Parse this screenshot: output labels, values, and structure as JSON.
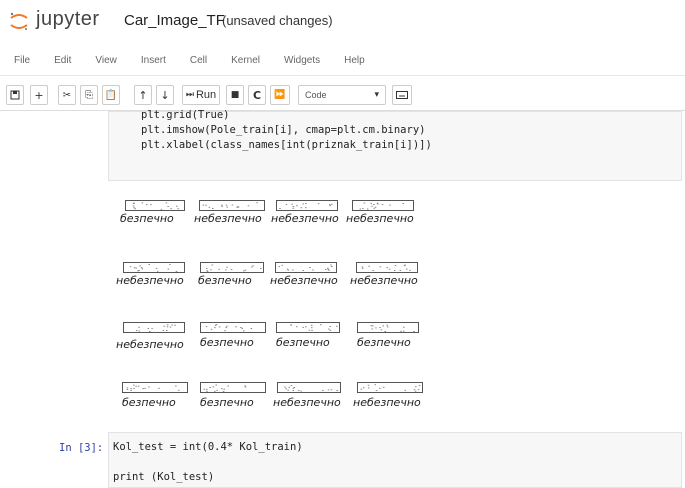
{
  "header": {
    "brand": "jupyter",
    "notebook_name": "Car_Image_TF",
    "save_state": "(unsaved changes)"
  },
  "menu": [
    "File",
    "Edit",
    "View",
    "Insert",
    "Cell",
    "Kernel",
    "Widgets",
    "Help"
  ],
  "toolbar": {
    "run_label": "Run",
    "cell_type": "Code",
    "icons": [
      "save-icon",
      "plus-icon",
      "cut-icon",
      "copy-icon",
      "paste-icon",
      "arrow-up-icon",
      "arrow-down-icon",
      "step-forward-icon",
      "stop-icon",
      "restart-icon",
      "fast-forward-icon",
      "keyboard-icon"
    ]
  },
  "code_cell": {
    "lines": [
      "plt.grid(True)",
      "plt.imshow(Pole_train[i], cmap=plt.cm.binary)",
      "plt.xlabel(class_names[int(priznak_train[i])])"
    ]
  },
  "output": {
    "rows": [
      [
        "безпечно",
        "небезпечно",
        "небезпечно",
        "небезпечно"
      ],
      [
        "небезпечно",
        "безпечно",
        "небезпечно",
        "небезпечно"
      ],
      [
        "небезпечно",
        "безпечно",
        "безпечно",
        "безпечно"
      ],
      [
        "безпечно",
        "безпечно",
        "небезпечно",
        "небезпечно"
      ]
    ]
  },
  "cell3": {
    "prompt": "In [3]:",
    "lines": [
      "Kol_test = int(0.4* Kol_train)",
      "print (Kol_test)"
    ]
  }
}
